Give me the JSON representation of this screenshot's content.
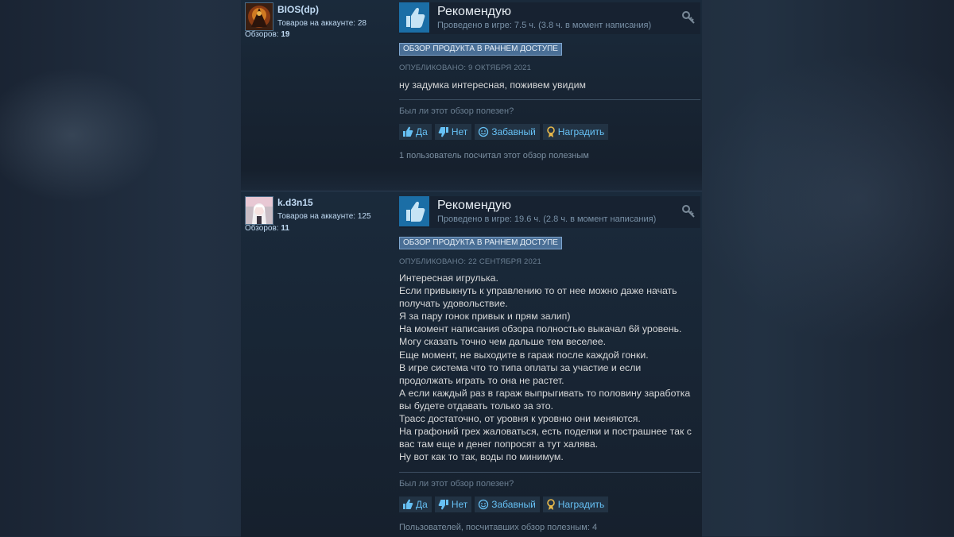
{
  "reviews": [
    {
      "author": "BIOS(dp)",
      "products_label": "Товаров на аккаунте:",
      "products_count": "28",
      "reviews_label": "Обзоров:",
      "reviews_count": "19",
      "verdict": "Рекомендую",
      "hours": "Проведено в игре: 7.5 ч. (3.8 ч. в момент написания)",
      "early_access": "ОБЗОР ПРОДУКТА В РАННЕМ ДОСТУПЕ",
      "posted": "ОПУБЛИКОВАНО: 9 ОКТЯБРЯ 2021",
      "text_lines": [
        "ну задумка интересная, поживем увидим"
      ],
      "helpful_question": "Был ли этот обзор полезен?",
      "helpful_count_text": "1 пользователь посчитал этот обзор полезным"
    },
    {
      "author": "k.d3n15",
      "products_label": "Товаров на аккаунте:",
      "products_count": "125",
      "reviews_label": "Обзоров:",
      "reviews_count": "11",
      "verdict": "Рекомендую",
      "hours": "Проведено в игре: 19.6 ч. (2.8 ч. в момент написания)",
      "early_access": "ОБЗОР ПРОДУКТА В РАННЕМ ДОСТУПЕ",
      "posted": "ОПУБЛИКОВАНО: 22 СЕНТЯБРЯ 2021",
      "text_lines": [
        "Интересная игрулька.",
        "Если привыкнуть к управлению то от нее можно даже начать",
        "получать удовольствие.",
        "Я за пару гонок привык и прям залип)",
        "На момент написания обзора полностью выкачал 6й уровень.",
        "Могу сказать точно чем дальше тем веселее.",
        "Еще момент, не выходите в гараж после каждой гонки.",
        "В игре система что то типа оплаты за участие и если",
        "продолжать играть то она не растет.",
        "А если каждый раз в гараж выпрыгивать то половину заработка",
        "вы будете отдавать только за это.",
        "Трасс достаточно, от уровня к уровню они меняются.",
        "На графоний грех жаловаться, есть поделки и пострашнее так с",
        "вас там еще и денег попросят а тут халява.",
        "Ну вот как то так, воды по минимум."
      ],
      "helpful_question": "Был ли этот обзор полезен?",
      "helpful_count_text": "Пользователей, посчитавших обзор полезным: 4"
    }
  ],
  "buttons": {
    "yes": "Да",
    "no": "Нет",
    "funny": "Забавный",
    "award": "Наградить"
  },
  "colors": {
    "link_blue": "#66c0f4",
    "thumb_bg": "#1b6ea6",
    "early_access_bg": "#4a6f96",
    "award_gold": "#e8b94a"
  },
  "icons": {
    "thumbs_up": "thumbs-up-icon",
    "thumbs_down": "thumbs-down-icon",
    "funny": "smiley-icon",
    "award": "award-ribbon-icon",
    "key": "key-icon"
  }
}
